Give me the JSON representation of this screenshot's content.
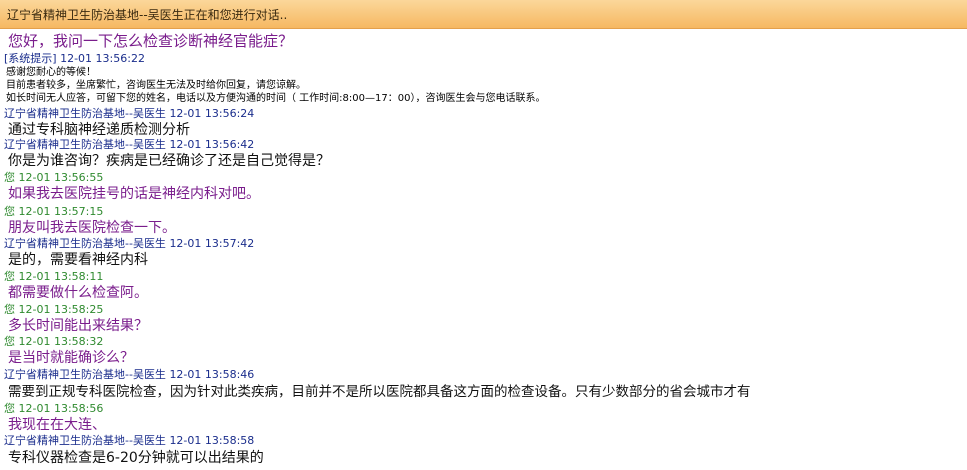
{
  "window": {
    "title": "辽宁省精神卫生防治基地--吴医生正在和您进行对话.."
  },
  "conversation": {
    "first_question": "您好，我问一下怎么检查诊断神经官能症？",
    "system_prompt": {
      "label": "[系统提示] 12-01 13:56:22",
      "lines": [
        "感谢您耐心的等候！",
        "目前患者较多，坐席繁忙，咨询医生无法及时给你回复，请您谅解。",
        "如长时间无人应答，可留下您的姓名，电话以及方便沟通的时间（ 工作时间:8:00—17：00），咨询医生会与您电话联系。"
      ]
    },
    "messages": [
      {
        "who": "doctor",
        "sender": "辽宁省精神卫生防治基地--吴医生",
        "time": "12-01 13:56:24",
        "text": "通过专科脑神经递质检测分析"
      },
      {
        "who": "doctor",
        "sender": "辽宁省精神卫生防治基地--吴医生",
        "time": "12-01 13:56:42",
        "text": "你是为谁咨询？疾病是已经确诊了还是自己觉得是？"
      },
      {
        "who": "me",
        "sender": "您",
        "time": "12-01 13:56:55",
        "text": "如果我去医院挂号的话是神经内科对吧。"
      },
      {
        "who": "me",
        "sender": "您",
        "time": "12-01 13:57:15",
        "text": "朋友叫我去医院检查一下。"
      },
      {
        "who": "doctor",
        "sender": "辽宁省精神卫生防治基地--吴医生",
        "time": "12-01 13:57:42",
        "text": "是的，需要看神经内科"
      },
      {
        "who": "me",
        "sender": "您",
        "time": "12-01 13:58:11",
        "text": "都需要做什么检查阿。"
      },
      {
        "who": "me",
        "sender": "您",
        "time": "12-01 13:58:25",
        "text": "多长时间能出来结果？"
      },
      {
        "who": "me",
        "sender": "您",
        "time": "12-01 13:58:32",
        "text": "是当时就能确诊么？"
      },
      {
        "who": "doctor",
        "sender": "辽宁省精神卫生防治基地--吴医生",
        "time": "12-01 13:58:46",
        "text": "需要到正规专科医院检查，因为针对此类疾病，目前并不是所以医院都具备这方面的检查设备。只有少数部分的省会城市才有"
      },
      {
        "who": "me",
        "sender": "您",
        "time": "12-01 13:58:56",
        "text": "我现在在大连、"
      },
      {
        "who": "doctor",
        "sender": "辽宁省精神卫生防治基地--吴医生",
        "time": "12-01 13:58:58",
        "text": "专科仪器检查是6-20分钟就可以出结果的"
      }
    ]
  },
  "colors": {
    "doctor_header": "#1a2d8c",
    "me_header": "#2f8a2f",
    "me_text": "#7a1d8c",
    "doctor_text": "#111111",
    "titlebar": "#f6b862"
  }
}
